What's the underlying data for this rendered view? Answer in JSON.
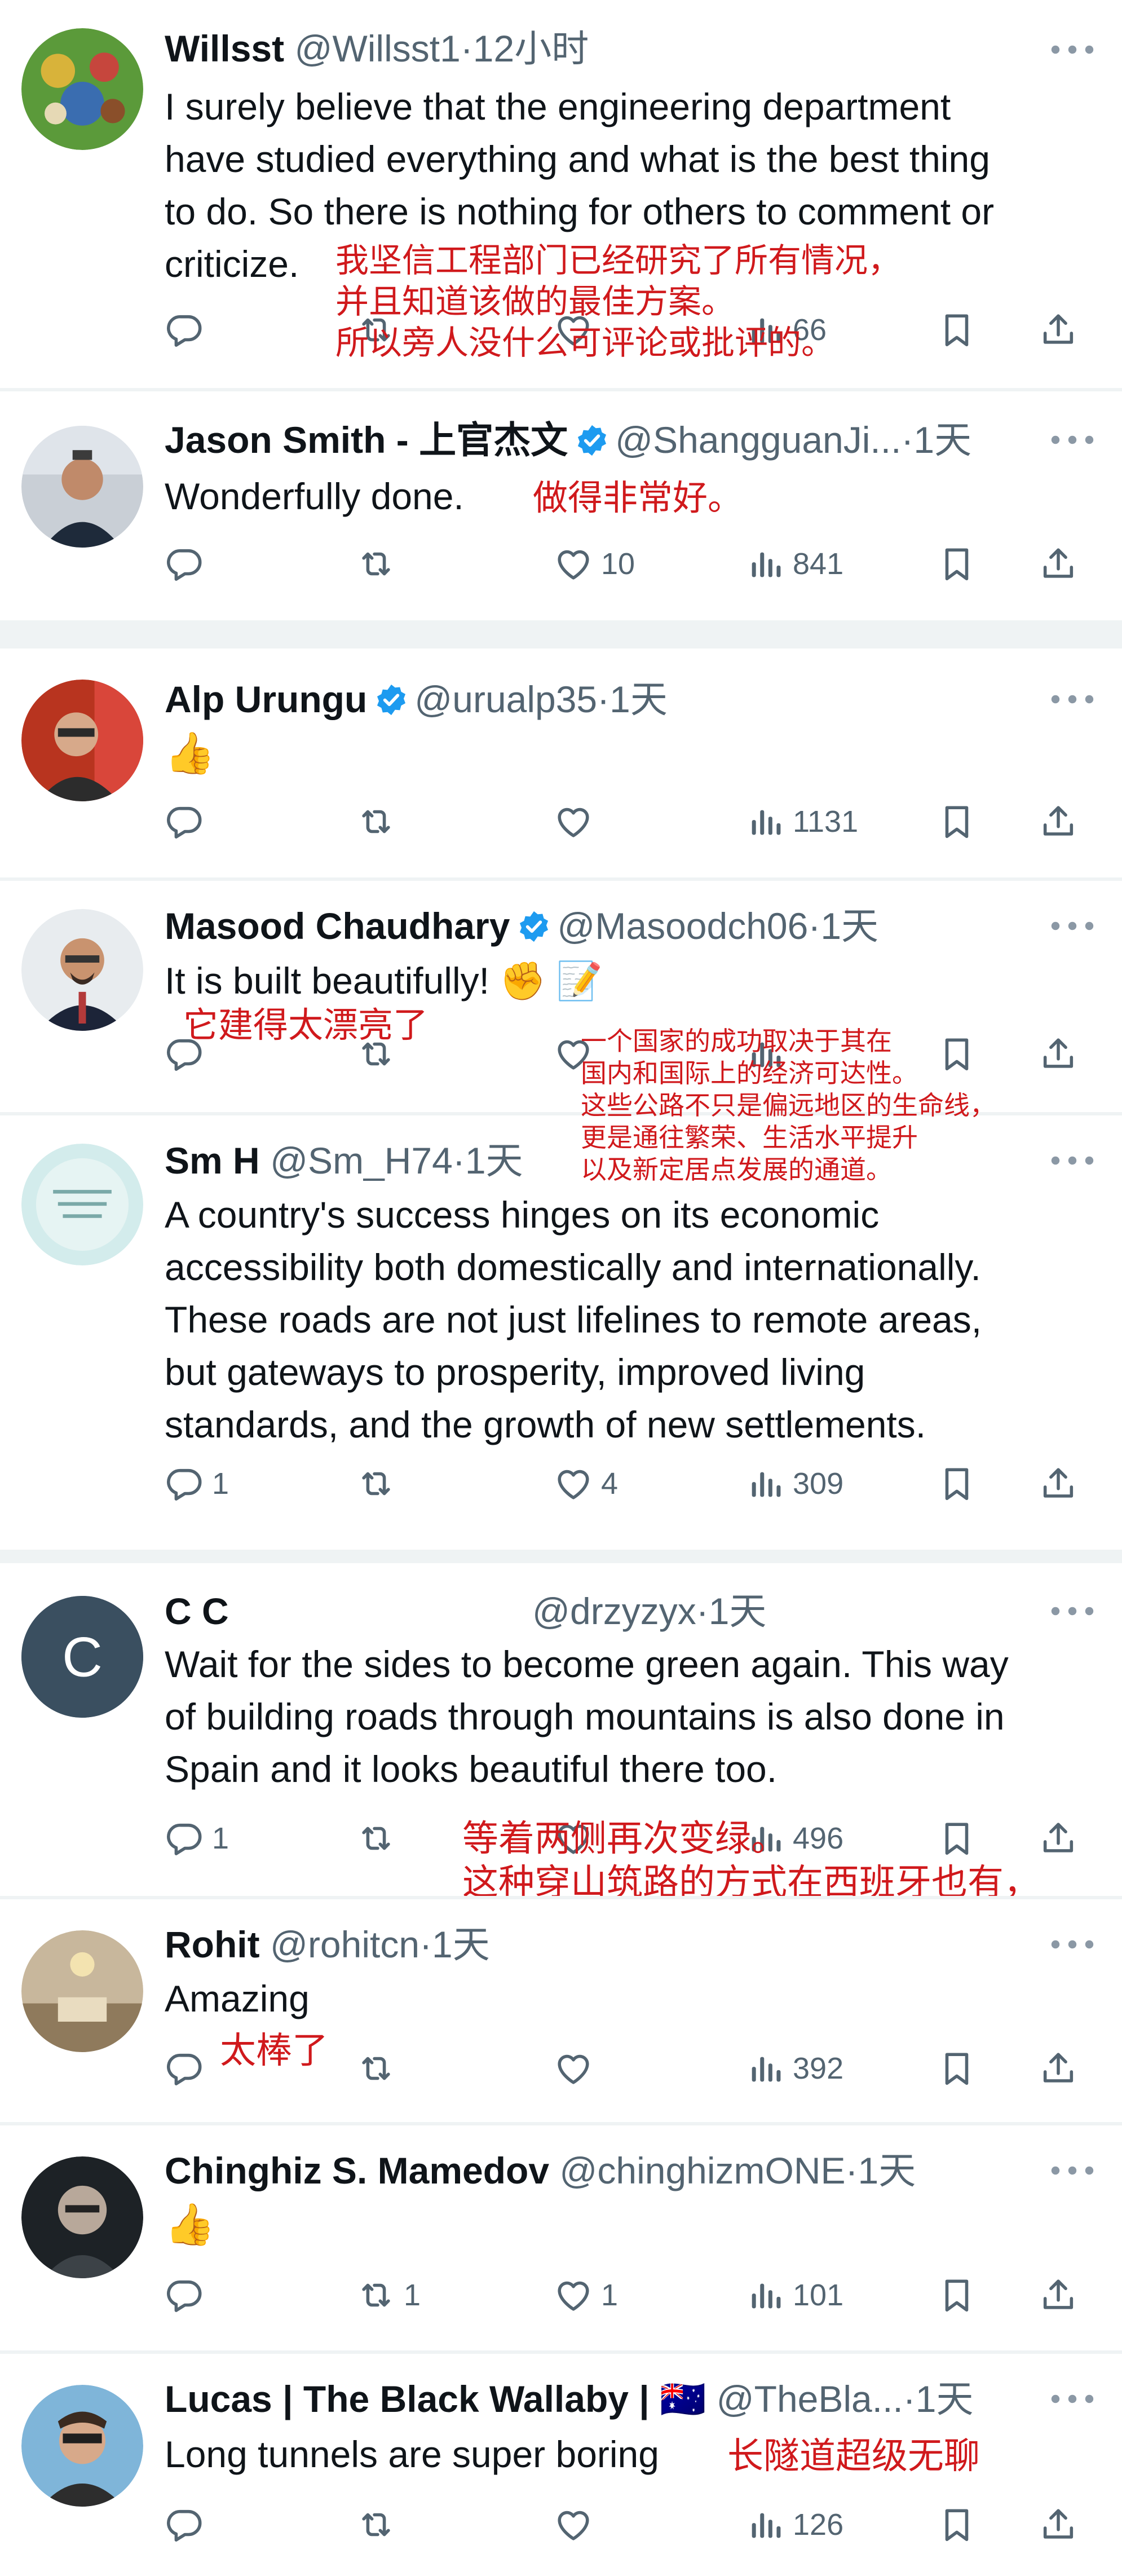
{
  "icons": {
    "reply": "reply-icon",
    "retweet": "retweet-icon",
    "like": "heart-icon",
    "views": "views-chart-icon",
    "bookmark": "bookmark-icon",
    "share": "share-icon",
    "more": "more-dots-icon",
    "verified": "verified-badge-icon"
  },
  "colors": {
    "annotation": "#d0191c",
    "verified": "#1d9bf0",
    "muted": "#536471",
    "divider": "#eff3f4"
  },
  "tweets": [
    {
      "name": "Willsst",
      "handle": "@Willsst1",
      "sep": "·",
      "time": "12小时",
      "text": "I surely believe that the engineering department\nhave studied everything and what is the best thing\nto do. So there is nothing for others to comment or\ncriticize.",
      "views": "66",
      "annotation": "我坚信工程部门已经研究了所有情况，\n并且知道该做的最佳方案。\n所以旁人没什么可评论或批评的。"
    },
    {
      "name": "Jason Smith - 上官杰文",
      "handle": "@ShangguanJi...",
      "sep": "·",
      "time": "1天",
      "text": "Wonderfully done.",
      "likes": "10",
      "views": "841",
      "annotation": "做得非常好。"
    },
    {
      "name": "Alp Urungu",
      "handle": "@urualp35",
      "sep": "·",
      "time": "1天",
      "text": "👍",
      "views": "1131"
    },
    {
      "name": "Masood Chaudhary",
      "handle": "@Masoodch06",
      "sep": "·",
      "time": "1天",
      "text": "It is built beautifully! ✊ 📝",
      "annotation": "它建得太漂亮了",
      "annotation2": "一个国家的成功取决于其在\n国内和国际上的经济可达性。\n这些公路不只是偏远地区的生命线，\n更是通往繁荣、生活水平提升\n以及新定居点发展的通道。"
    },
    {
      "name": "Sm H",
      "handle": "@Sm_H74",
      "sep": "·",
      "time": "1天",
      "text": "A country's success hinges on its economic\naccessibility both domestically and internationally.\nThese roads are not just lifelines to remote areas,\nbut gateways to prosperity, improved living\nstandards, and the growth of new settlements.",
      "replies": "1",
      "likes": "4",
      "views": "309"
    },
    {
      "name": "C C",
      "handle": "@drzyzyx",
      "sep": "·",
      "time": "1天",
      "avatar_letter": "C",
      "text": "Wait for the sides to become green again. This way\nof building roads through mountains is also done in\nSpain and it looks beautiful there too.",
      "replies": "1",
      "views": "496",
      "annotation": "等着两侧再次变绿。\n这种穿山筑路的方式在西班牙也有，\n在那儿看着也很美。"
    },
    {
      "name": "Rohit",
      "handle": "@rohitcn",
      "sep": "·",
      "time": "1天",
      "text": "Amazing",
      "views": "392",
      "annotation": "太棒了"
    },
    {
      "name": "Chinghiz S. Mamedov",
      "handle": "@chinghizmONE",
      "sep": "·",
      "time": "1天",
      "text": "👍",
      "retweets": "1",
      "likes": "1",
      "views": "101"
    },
    {
      "name": "Lucas | The Black Wallaby | 🇦🇺",
      "handle": "@TheBla...",
      "sep": "·",
      "time": "1天",
      "text": "Long tunnels are super boring",
      "views": "126",
      "annotation": "长隧道超级无聊"
    }
  ]
}
